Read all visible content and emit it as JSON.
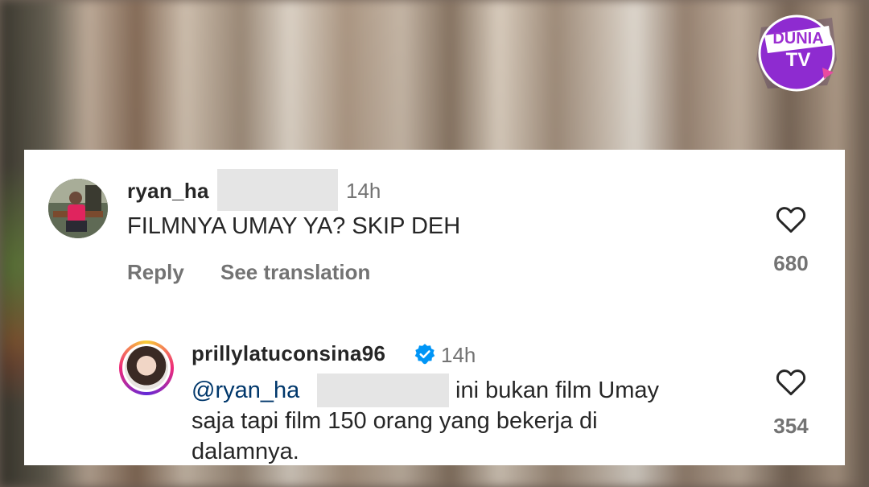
{
  "watermark": {
    "line1": "DUNIA",
    "line2": "TV"
  },
  "comments": [
    {
      "username": "ryan_ha",
      "time": "14h",
      "text": "FILMNYA UMAY YA? SKIP DEH",
      "actions": {
        "reply": "Reply",
        "translate": "See translation"
      },
      "likes": "680"
    },
    {
      "username": "prillylatuconsina96",
      "time": "14h",
      "mention": "@ryan_ha",
      "text_line1": "ini bukan film Umay",
      "text_line2": "saja tapi film 150 orang yang bekerja di",
      "text_line3": "dalamnya.",
      "likes": "354"
    }
  ],
  "colors": {
    "accent_purple": "#9b2fd1",
    "verified_blue": "#0095f6",
    "text": "#262626",
    "muted": "#737373"
  },
  "icons": {
    "like": "heart-outline-icon",
    "verified": "verified-badge-icon"
  }
}
